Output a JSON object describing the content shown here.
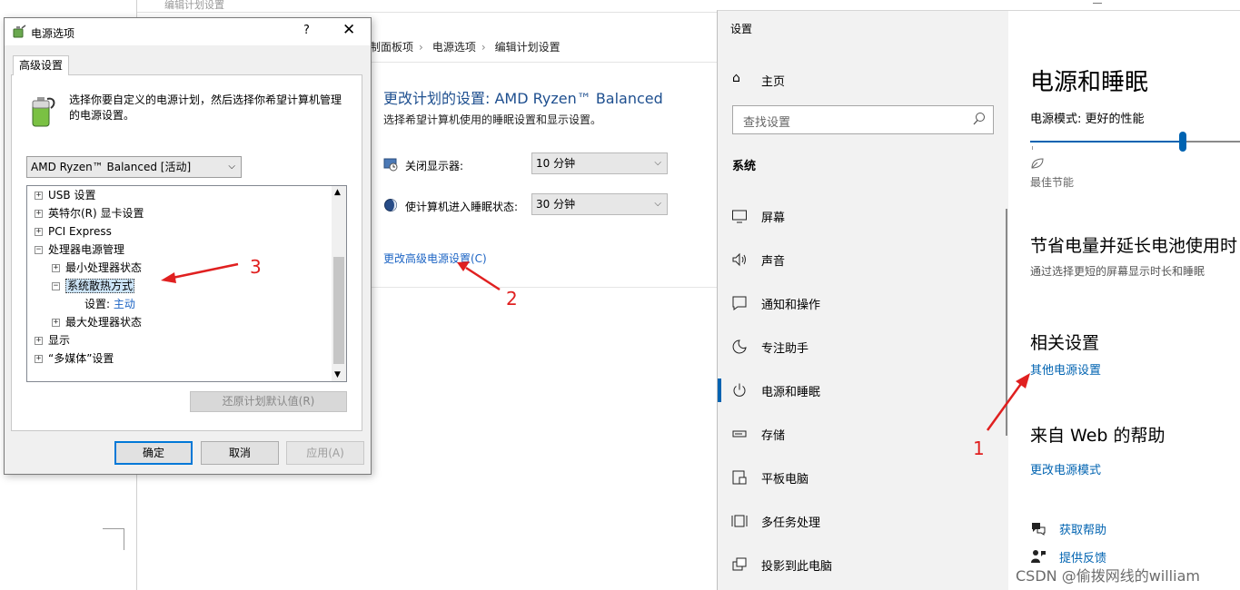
{
  "edit_window": {
    "title": "编辑计划设置",
    "breadcrumb": [
      "制面板项",
      "电源选项",
      "编辑计划设置"
    ],
    "breadcrumb_sep": "›",
    "plan_title": "更改计划的设置: AMD Ryzen™ Balanced",
    "plan_subtitle": "选择希望计算机使用的睡眠设置和显示设置。",
    "display_off_label": "关闭显示器:",
    "display_off_value": "10 分钟",
    "sleep_label": "使计算机进入睡眠状态:",
    "sleep_value": "30 分钟",
    "advanced_link": "更改高级电源设置(C)"
  },
  "dialog": {
    "title": "电源选项",
    "help": "?",
    "close": "✕",
    "tab": "高级设置",
    "intro": "选择你要自定义的电源计划，然后选择你希望计算机管理的电源设置。",
    "plan_select": "AMD Ryzen™ Balanced [活动]",
    "tree": [
      {
        "toggle": "+",
        "label": "USB 设置"
      },
      {
        "toggle": "+",
        "label": "英特尔(R) 显卡设置"
      },
      {
        "toggle": "+",
        "label": "PCI Express"
      },
      {
        "toggle": "−",
        "label": "处理器电源管理"
      },
      {
        "toggle": "+",
        "label": "最小处理器状态"
      },
      {
        "toggle": "−",
        "label": "系统散热方式"
      },
      {
        "label": "设置:",
        "value": "主动"
      },
      {
        "toggle": "+",
        "label": "最大处理器状态"
      },
      {
        "toggle": "+",
        "label": "显示"
      },
      {
        "toggle": "+",
        "label": "“多媒体”设置"
      }
    ],
    "restore_button": "还原计划默认值(R)",
    "ok_button": "确定",
    "cancel_button": "取消",
    "apply_button": "应用(A)"
  },
  "settings": {
    "app_title": "设置",
    "home": "主页",
    "search_placeholder": "查找设置",
    "group": "系统",
    "nav_items": [
      {
        "icon": "monitor-icon",
        "label": "屏幕"
      },
      {
        "icon": "speaker-icon",
        "label": "声音"
      },
      {
        "icon": "notification-icon",
        "label": "通知和操作"
      },
      {
        "icon": "moon-icon",
        "label": "专注助手"
      },
      {
        "icon": "power-icon",
        "label": "电源和睡眠",
        "active": true
      },
      {
        "icon": "storage-icon",
        "label": "存储"
      },
      {
        "icon": "tablet-icon",
        "label": "平板电脑"
      },
      {
        "icon": "multitask-icon",
        "label": "多任务处理"
      },
      {
        "icon": "project-icon",
        "label": "投影到此电脑"
      }
    ],
    "page_title": "电源和睡眠",
    "power_mode_label": "电源模式: 更好的性能",
    "power_mode_fraction": 0.7,
    "best_battery_label": "最佳节能",
    "save_energy_heading": "节省电量并延长电池使用时",
    "save_energy_desc": "通过选择更短的屏幕显示时长和睡眠",
    "related_heading": "相关设置",
    "other_power_link": "其他电源设置",
    "web_help_heading": "来自 Web 的帮助",
    "change_mode_link": "更改电源模式",
    "get_help": "获取帮助",
    "feedback": "提供反馈"
  },
  "annotations": {
    "arrow_color": "#e02020",
    "labels": [
      "1",
      "2",
      "3"
    ]
  },
  "watermark": "CSDN @偷拨网线的william",
  "colors": {
    "accent": "#0063b1",
    "link": "#1c64c4",
    "annotation": "#e02020"
  }
}
